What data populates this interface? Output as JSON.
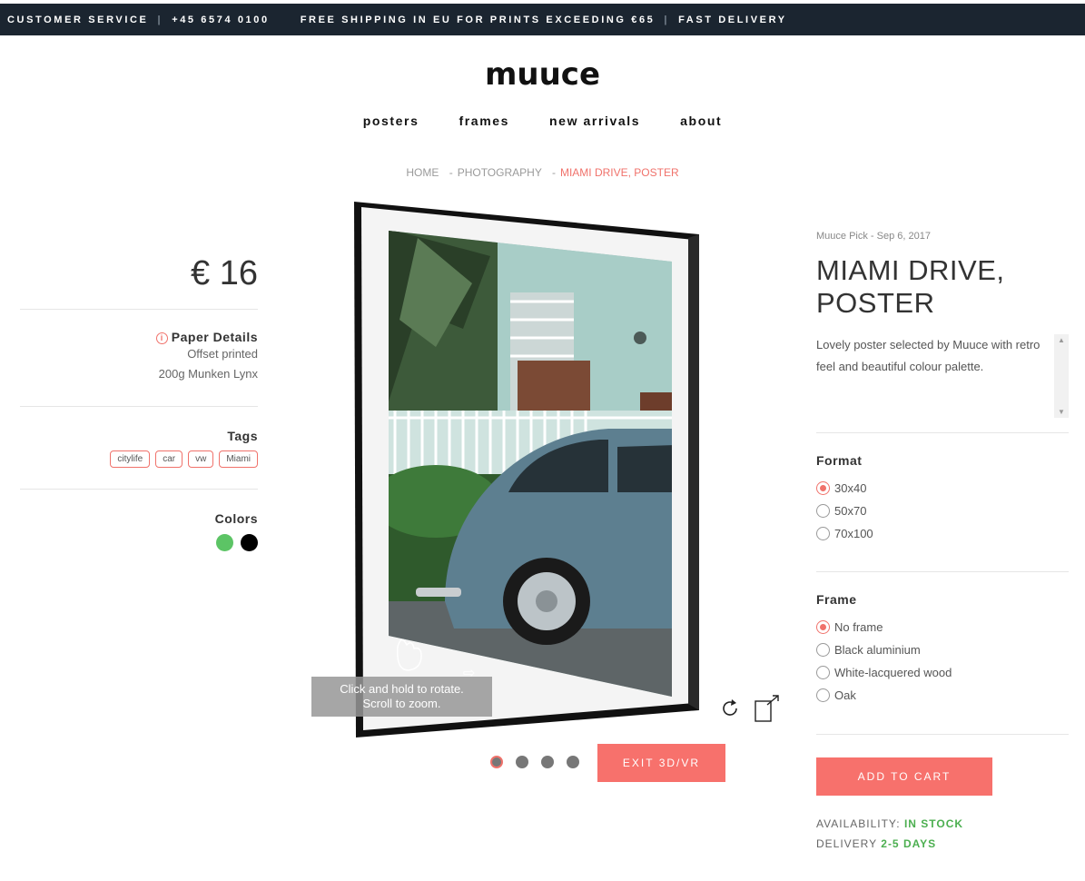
{
  "topbar": {
    "customer_service": "CUSTOMER SERVICE",
    "phone": "+45 6574 0100",
    "shipping": "FREE SHIPPING IN EU FOR PRINTS EXCEEDING €65",
    "delivery": "FAST DELIVERY"
  },
  "logo": "muuce",
  "nav": {
    "posters": "posters",
    "frames": "frames",
    "new_arrivals": "new arrivals",
    "about": "about"
  },
  "breadcrumb": {
    "home": "HOME",
    "category": "PHOTOGRAPHY",
    "current": "MIAMI DRIVE, POSTER"
  },
  "product": {
    "price": "€ 16",
    "paper_title": "Paper Details",
    "paper_line1": "Offset printed",
    "paper_line2": "200g Munken Lynx",
    "tags_title": "Tags",
    "tags": [
      "citylife",
      "car",
      "vw",
      "Miami"
    ],
    "colors_title": "Colors",
    "colors": [
      "#5cc465",
      "#000000"
    ],
    "meta": "Muuce Pick - Sep 6, 2017",
    "title_line1": "MIAMI DRIVE,",
    "title_line2": "POSTER",
    "description": "Lovely poster selected by Muuce with retro feel and beautiful colour palette."
  },
  "viewer": {
    "tooltip_line1": "Click and hold to rotate.",
    "tooltip_line2": "Scroll to zoom.",
    "exit_label": "EXIT 3D/VR"
  },
  "format": {
    "title": "Format",
    "options": [
      "30x40",
      "50x70",
      "70x100"
    ],
    "selected": "30x40"
  },
  "frame": {
    "title": "Frame",
    "options": [
      "No frame",
      "Black aluminium",
      "White-lacquered wood",
      "Oak"
    ],
    "selected": "No frame"
  },
  "cart": {
    "add_label": "ADD TO CART",
    "availability_label": "AVAILABILITY:",
    "availability_value": "IN STOCK",
    "delivery_label": "DELIVERY",
    "delivery_value": "2-5 DAYS"
  }
}
